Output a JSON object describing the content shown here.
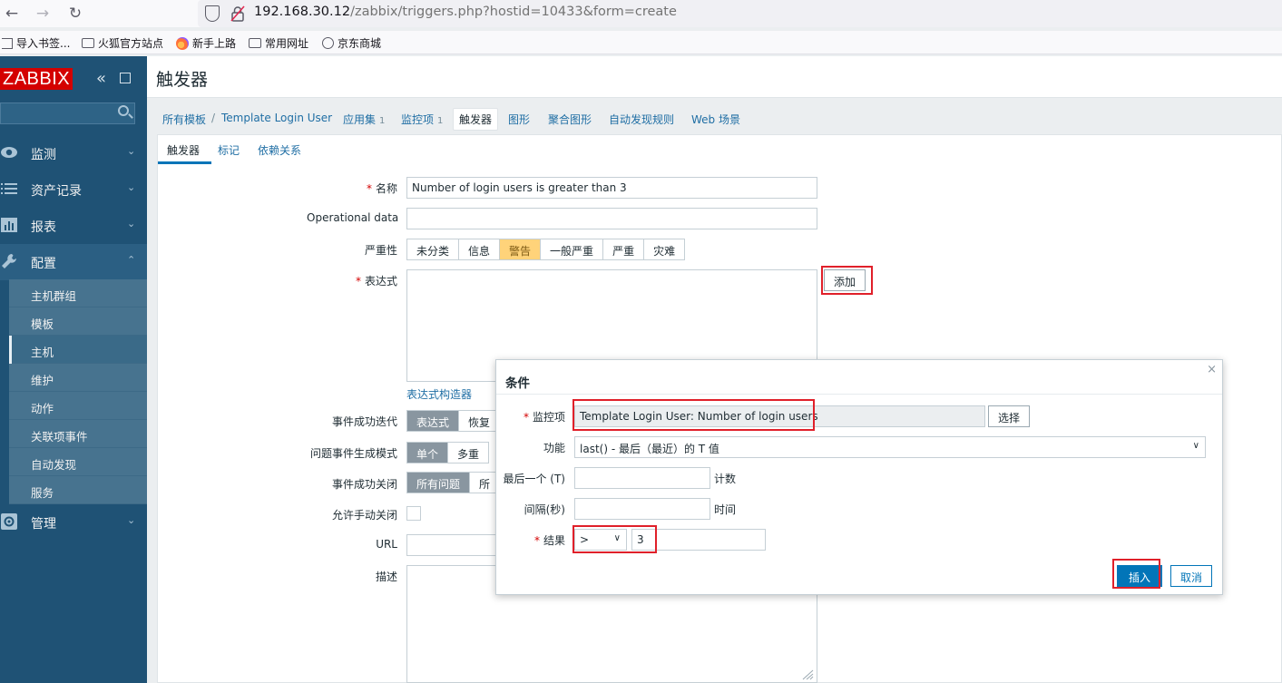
{
  "browser": {
    "url_host": "192.168.30.12",
    "url_path": "/zabbix/triggers.php?hostid=10433&form=create",
    "bookmarks": [
      "导入书签...",
      "火狐官方站点",
      "新手上路",
      "常用网址",
      "京东商城"
    ]
  },
  "sidebar": {
    "logo": "ZABBIX",
    "menu": [
      {
        "label": "监测",
        "icon": "eye-icon"
      },
      {
        "label": "资产记录",
        "icon": "list-icon"
      },
      {
        "label": "报表",
        "icon": "bar-chart-icon"
      },
      {
        "label": "配置",
        "icon": "wrench-icon"
      },
      {
        "label": "管理",
        "icon": "gear-icon"
      }
    ],
    "submenu": [
      "主机群组",
      "模板",
      "主机",
      "维护",
      "动作",
      "关联项事件",
      "自动发现",
      "服务"
    ]
  },
  "header": {
    "title": "触发器"
  },
  "breadcrumbs": {
    "all_templates": "所有模板",
    "sep": "/",
    "template": "Template Login User",
    "applications": "应用集",
    "applications_count": "1",
    "items": "监控项",
    "items_count": "1",
    "triggers": "触发器",
    "graphs": "图形",
    "screens": "聚合图形",
    "discovery": "自动发现规则",
    "web": "Web 场景"
  },
  "tabs": [
    "触发器",
    "标记",
    "依赖关系"
  ],
  "form": {
    "name_label": "名称",
    "name_value": "Number of login users is greater than 3",
    "opdata_label": "Operational data",
    "severity_label": "严重性",
    "severities": [
      "未分类",
      "信息",
      "警告",
      "一般严重",
      "严重",
      "灾难"
    ],
    "expression_label": "表达式",
    "add_button": "添加",
    "expr_builder": "表达式构造器",
    "ok_event_label": "事件成功迭代",
    "ok_event_options": [
      "表达式",
      "恢复"
    ],
    "problem_mode_label": "问题事件生成模式",
    "problem_mode_options": [
      "单个",
      "多重"
    ],
    "ok_close_label": "事件成功关闭",
    "ok_close_options": [
      "所有问题",
      "所"
    ],
    "manual_close_label": "允许手动关闭",
    "url_label": "URL",
    "desc_label": "描述"
  },
  "dialog": {
    "title": "条件",
    "item_label": "监控项",
    "item_value": "Template Login User: Number of login users",
    "select_button": "选择",
    "function_label": "功能",
    "function_value": "last() - 最后（最近）的 T 值",
    "last_label": "最后一个 (T)",
    "last_suffix": "计数",
    "interval_label": "间隔(秒)",
    "interval_suffix": "时间",
    "result_label": "结果",
    "operator_value": ">",
    "result_value": "3",
    "insert_button": "插入",
    "cancel_button": "取消"
  }
}
